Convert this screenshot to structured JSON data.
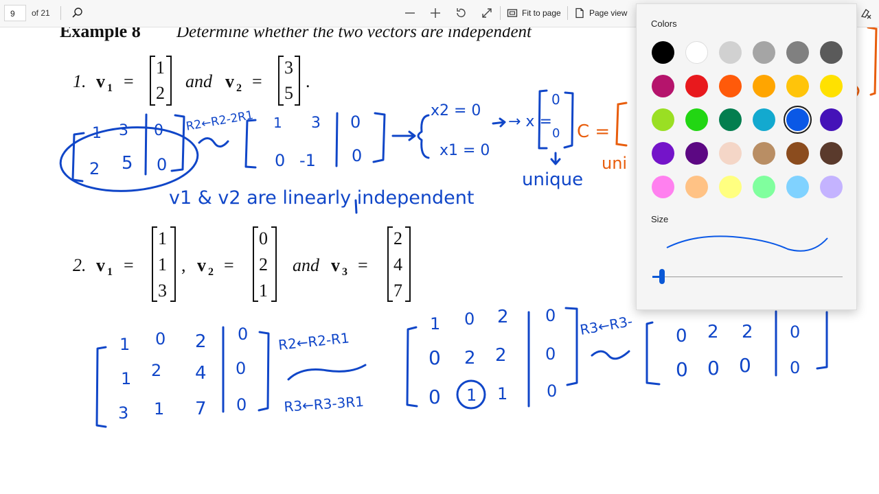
{
  "toolbar": {
    "page_number": "9",
    "page_count": "of 21",
    "fit_label": "Fit to page",
    "view_label": "Page view",
    "icons": [
      "search-icon",
      "zoom-out-icon",
      "zoom-in-icon",
      "rotate-icon",
      "fullscreen-icon",
      "fit-page-icon",
      "page-view-icon",
      "clear-ink-icon"
    ]
  },
  "document": {
    "example_label": "Example 8",
    "example_text": "Determine whether the two vectors are independent",
    "item1_number": "1.",
    "item2_number": "2.",
    "and_word": "and",
    "v1": "v",
    "v2": "v",
    "v3": "v",
    "sub1": "1",
    "sub2": "2",
    "sub3": "3",
    "equals": "=",
    "period": ".",
    "comma": ",",
    "item1_v1": [
      "1",
      "2"
    ],
    "item1_v2": [
      "3",
      "5"
    ],
    "item2_v1": [
      "1",
      "1",
      "3"
    ],
    "item2_v2": [
      "0",
      "2",
      "1"
    ],
    "item2_v3": [
      "2",
      "4",
      "7"
    ]
  },
  "ink": {
    "aug1": [
      "1",
      "3",
      "0",
      "2",
      "5",
      "0"
    ],
    "aug1_reduced": [
      "1",
      "3",
      "0",
      "0",
      "-1",
      "0"
    ],
    "op1": "R2←R2-2R1",
    "sys_x2": "x2 = 0",
    "sys_x1": "x1 = 0",
    "x_eq": "→ x =",
    "x_vec": [
      "0",
      "0"
    ],
    "unique": "unique",
    "conclusion": "v1 & v2 are linearly independent",
    "aug2": [
      "1",
      "0",
      "2",
      "0",
      "1",
      "2",
      "4",
      "0",
      "3",
      "1",
      "7",
      "0"
    ],
    "op2a": "R2←R2-R1",
    "op2b": "R3←R3-3R1",
    "aug2_reduced": [
      "1",
      "0",
      "2",
      "0",
      "0",
      "2",
      "2",
      "0",
      "0",
      "1",
      "1",
      "0"
    ],
    "op3": "R3←R3-",
    "aug3_rows": [
      "0",
      "2",
      "2",
      "0",
      "0",
      "0",
      "0",
      "0"
    ],
    "orange_c": "C =",
    "orange_uni": "uni",
    "blue_ink": "#1046c8",
    "orange_ink": "#e85d0c"
  },
  "panel": {
    "colors_label": "Colors",
    "size_label": "Size",
    "selected_color": "#0a58e6",
    "colors": [
      "#000000",
      "#ffffff",
      "#d1d1d1",
      "#a5a5a5",
      "#808080",
      "#5a5a5a",
      "#b5146c",
      "#e8191d",
      "#ff5a0a",
      "#ffa500",
      "#ffc40a",
      "#ffe100",
      "#9adf23",
      "#22d613",
      "#037e4f",
      "#13a9cf",
      "#0a58e6",
      "#4412b8",
      "#7414c9",
      "#5c0883",
      "#f4d6c7",
      "#b98e64",
      "#8b4c1e",
      "#5a3a2c",
      "#ff80ef",
      "#ffc285",
      "#ffff80",
      "#80ff9e",
      "#80d2ff",
      "#c4b3ff"
    ]
  }
}
